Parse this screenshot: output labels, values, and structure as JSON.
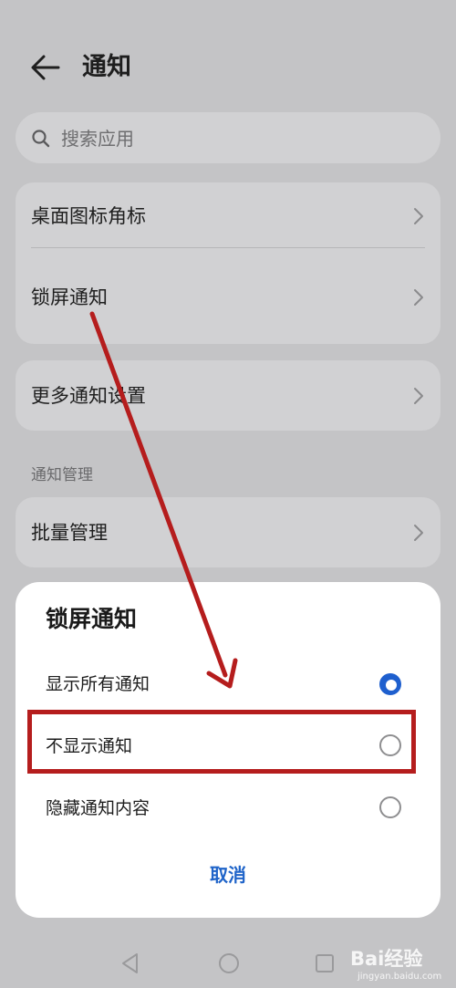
{
  "header": {
    "title": "通知"
  },
  "search": {
    "placeholder": "搜索应用"
  },
  "settings": {
    "group1": [
      "桌面图标角标",
      "锁屏通知"
    ],
    "group2": [
      "更多通知设置"
    ],
    "section_label": "通知管理",
    "group3": [
      "批量管理"
    ]
  },
  "dialog": {
    "title": "锁屏通知",
    "options": [
      {
        "label": "显示所有通知",
        "selected": true
      },
      {
        "label": "不显示通知",
        "selected": false
      },
      {
        "label": "隐藏通知内容",
        "selected": false
      }
    ],
    "cancel_label": "取消"
  },
  "watermark": {
    "text": "Bai经验",
    "sub": "jingyan.baidu.com"
  },
  "icons": {
    "back": "back-arrow-icon",
    "search": "search-icon",
    "chevron": "chevron-right-icon",
    "nav": [
      "nav-back-icon",
      "nav-home-icon",
      "nav-recent-icon"
    ]
  },
  "colors": {
    "accent": "#1e5fce",
    "annotation": "#b51d1d",
    "dim_background": "#c4c4c6"
  }
}
